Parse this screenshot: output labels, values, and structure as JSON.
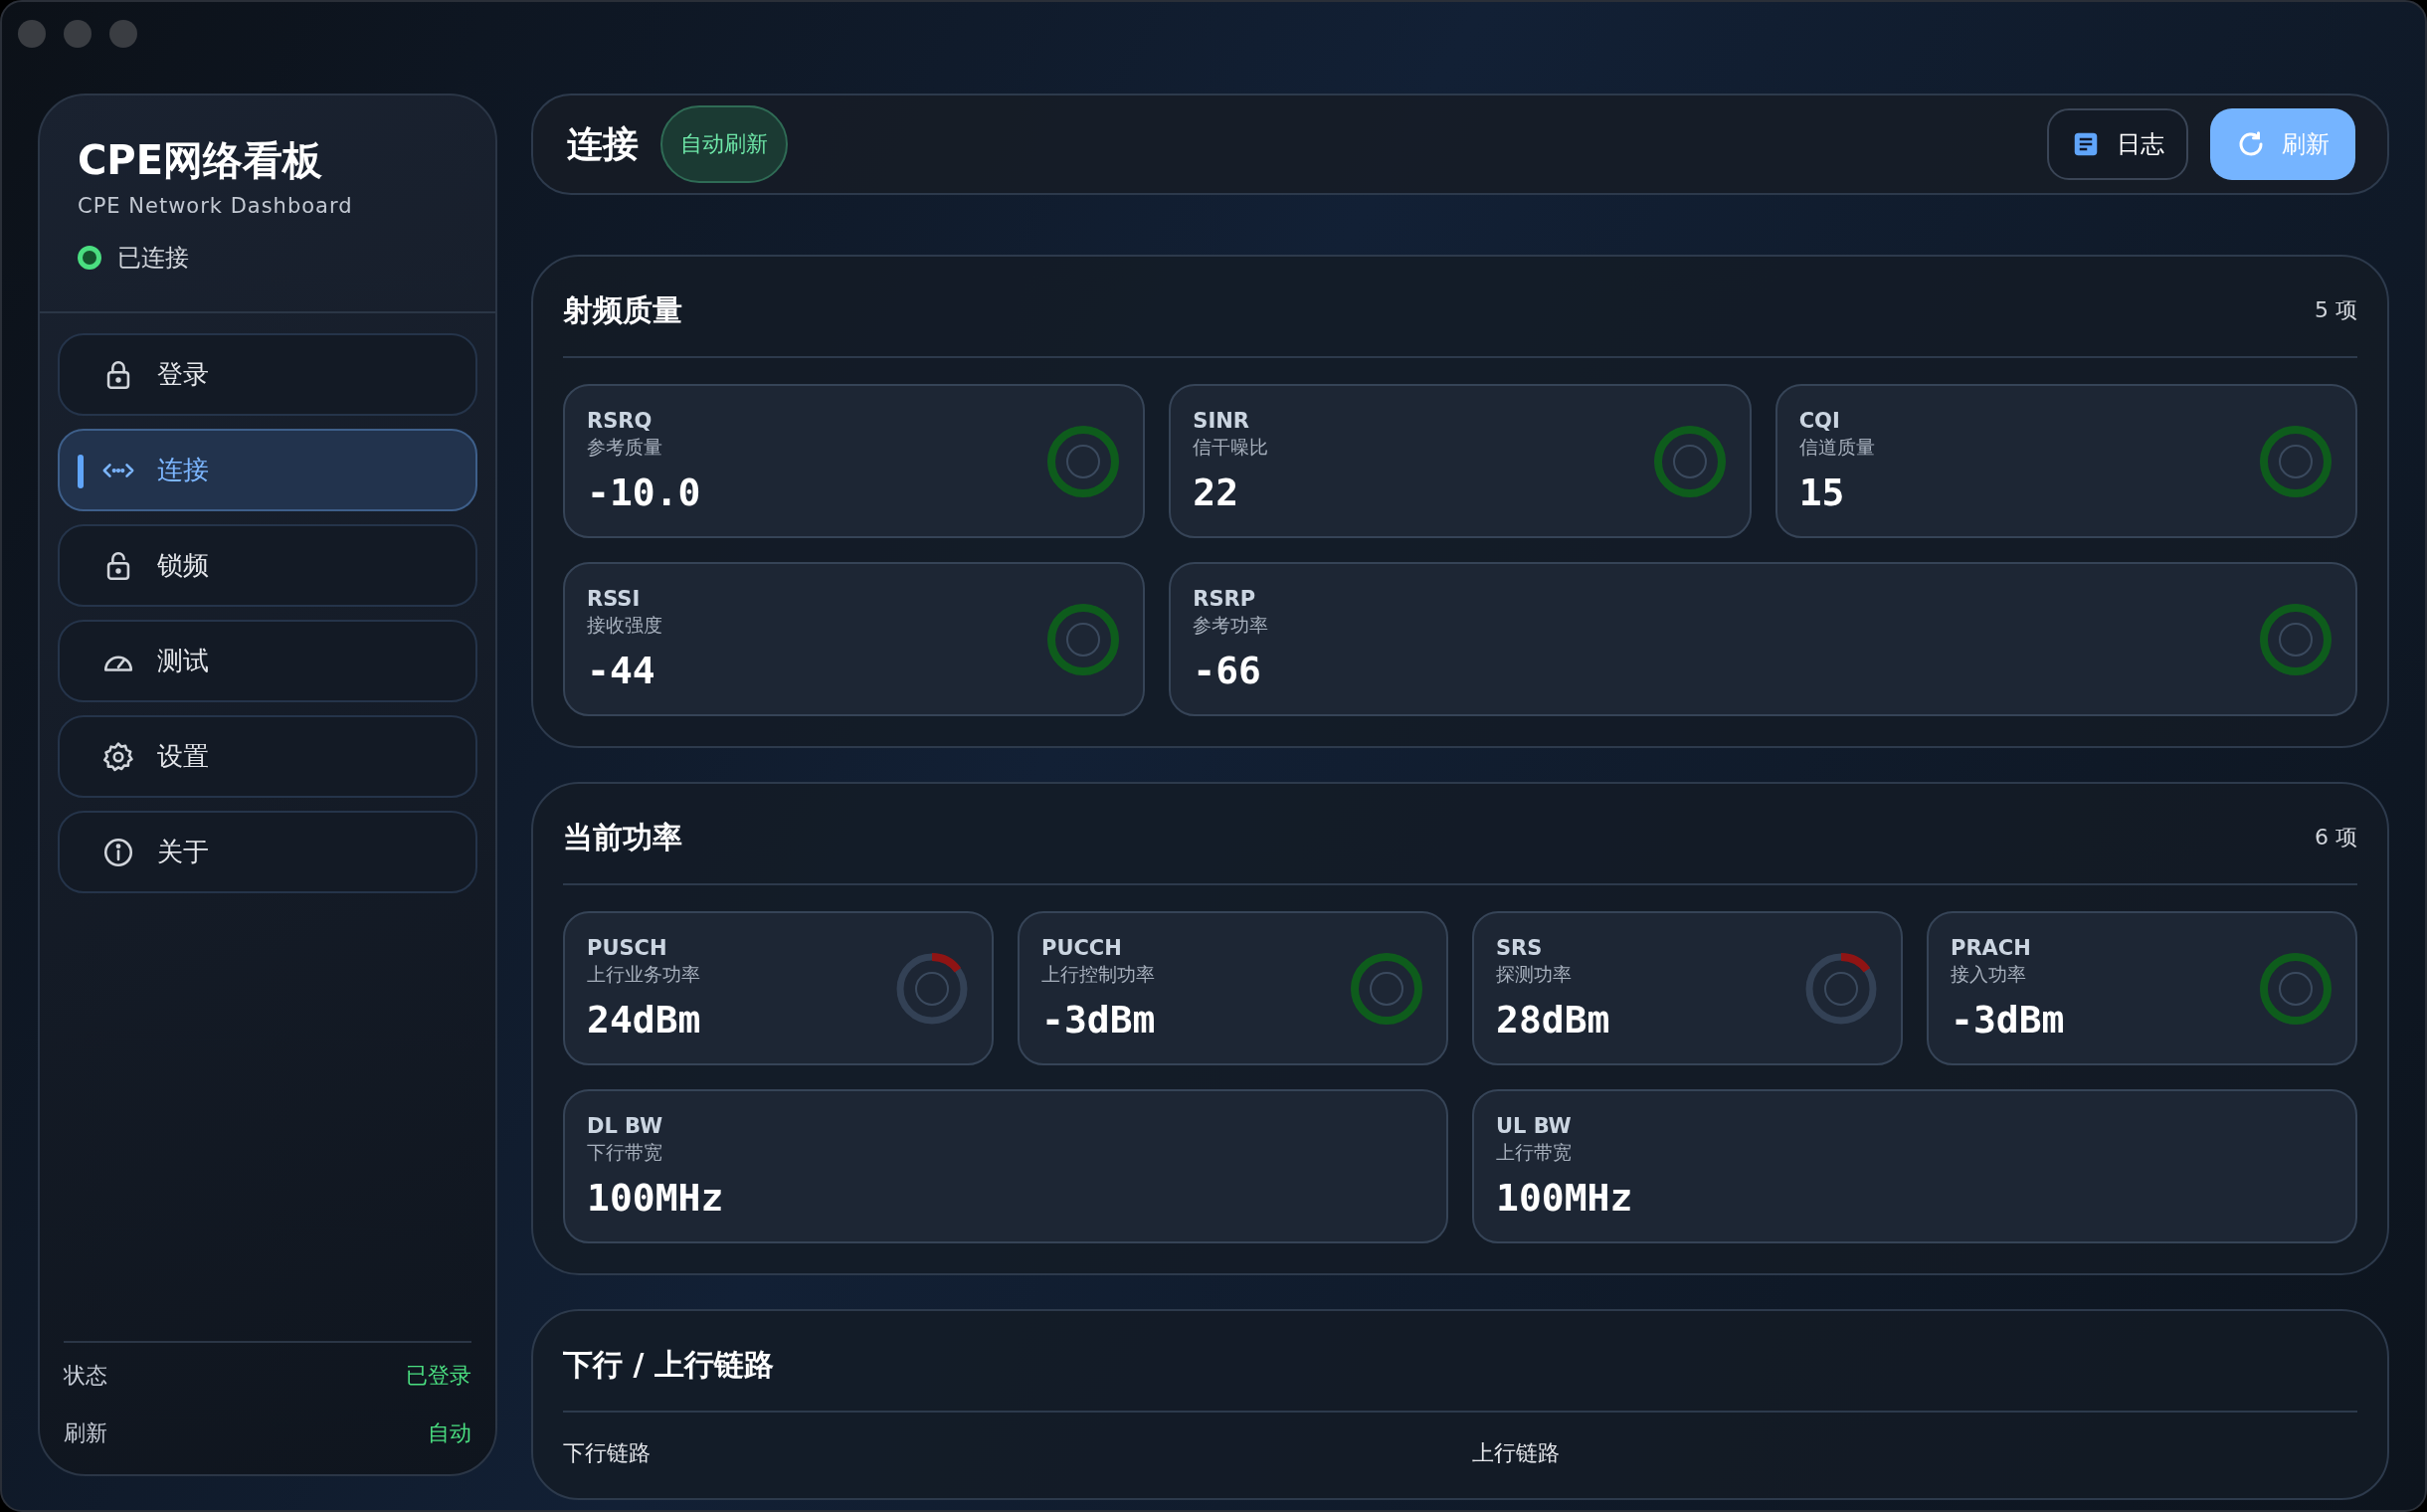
{
  "sidebar": {
    "title": "CPE网络看板",
    "subtitle": "CPE Network Dashboard",
    "connection": {
      "label": "已连接",
      "connected": true
    },
    "nav": [
      {
        "label": "登录",
        "selected": false
      },
      {
        "label": "连接",
        "selected": true
      },
      {
        "label": "锁频",
        "selected": false
      },
      {
        "label": "测试",
        "selected": false
      },
      {
        "label": "设置",
        "selected": false
      },
      {
        "label": "关于",
        "selected": false
      }
    ],
    "footer": [
      {
        "label": "状态",
        "value": "已登录"
      },
      {
        "label": "刷新",
        "value": "自动"
      }
    ]
  },
  "header": {
    "title": "连接",
    "badge": "自动刷新",
    "buttons": [
      {
        "label": "日志",
        "kind": "log"
      },
      {
        "label": "刷新",
        "kind": "refresh"
      }
    ]
  },
  "sections": [
    {
      "title": "射频质量",
      "count": "5 项",
      "groups": [
        {
          "cards": [
            {
              "name": "RSRQ",
              "desc": "参考质量",
              "value": "-10.0",
              "color": "#0e5c1c",
              "level": 1
            },
            {
              "name": "SINR",
              "desc": "信干噪比",
              "value": "22",
              "color": "#0e5c1c",
              "level": 1
            },
            {
              "name": "CQI",
              "desc": "信道质量",
              "value": "15",
              "color": "#0e5c1c",
              "level": 1
            }
          ]
        },
        {
          "cards": [
            {
              "name": "RSSI",
              "desc": "接收强度",
              "value": "-44",
              "color": "#0e5c1c",
              "level": 1
            },
            {
              "name": "RSRP",
              "desc": "参考功率",
              "value": "-66",
              "color": "#0e5c1c",
              "level": 1
            }
          ]
        }
      ]
    },
    {
      "title": "当前功率",
      "count": "6 项",
      "groups": [
        {
          "cards": [
            {
              "name": "PUSCH",
              "desc": "上行业务功率",
              "value": "24dBm",
              "color": "#8f1414",
              "level": 0.15
            },
            {
              "name": "PUCCH",
              "desc": "上行控制功率",
              "value": "-3dBm",
              "color": "#0e5c1c",
              "level": 1
            },
            {
              "name": "SRS",
              "desc": "探测功率",
              "value": "28dBm",
              "color": "#8f1414",
              "level": 0.15
            },
            {
              "name": "PRACH",
              "desc": "接入功率",
              "value": "-3dBm",
              "color": "#0e5c1c",
              "level": 1
            }
          ]
        },
        {
          "cards": [
            {
              "name": "DL BW",
              "desc": "下行带宽",
              "value": "100MHz"
            },
            {
              "name": "UL BW",
              "desc": "上行带宽",
              "value": "100MHz"
            }
          ]
        }
      ]
    },
    {
      "title": "下行 / 上行链路",
      "columns": [
        "下行链路",
        "上行链路"
      ]
    }
  ]
}
